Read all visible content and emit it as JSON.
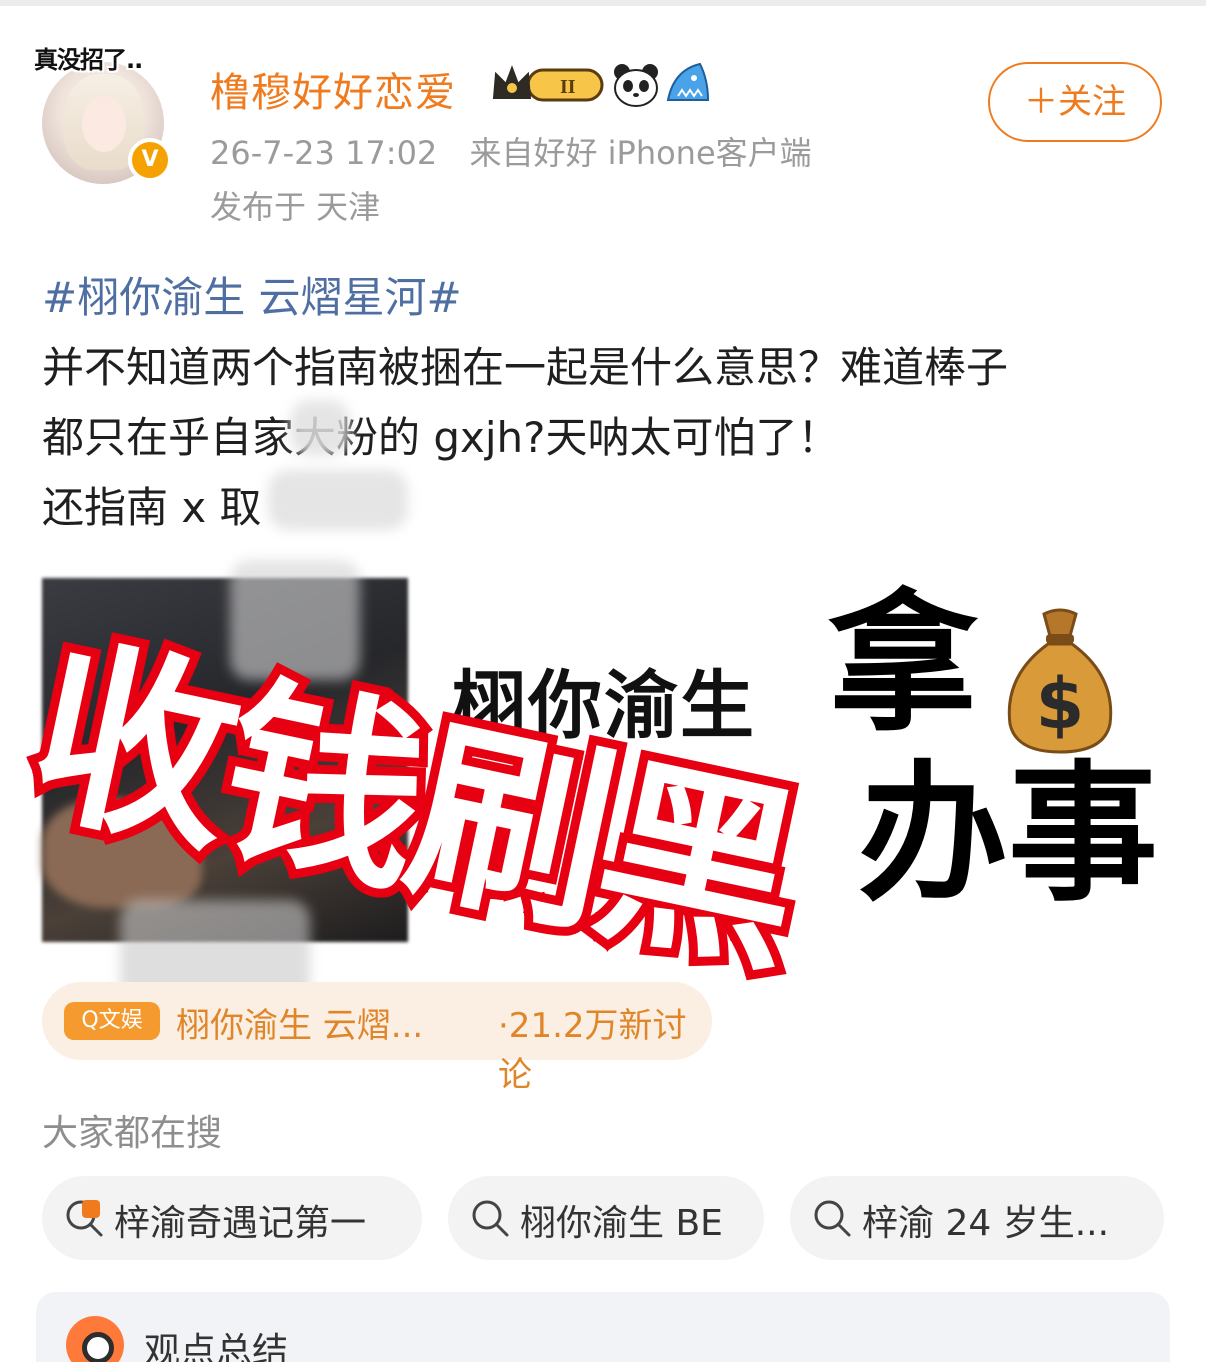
{
  "header": {
    "avatar_tag": "真没招了..",
    "username": "橹穆好好恋爱",
    "vip_level": "II",
    "timestamp": "26-7-23 17:02",
    "source": "来自好好 iPhone客户端",
    "location": "发布于 天津",
    "follow_label": "＋关注",
    "verified_mark": "V"
  },
  "post": {
    "topic": "#栩你渝生 云熠星河#",
    "line1": "并不知道两个指南被捆在一起是什么意思？难道棒子",
    "line2": "都只在乎自家大粉的 gxjh?天呐太可怕了！",
    "line3": "还指南 x 取"
  },
  "media": {
    "image_text": "栩你渝生",
    "big_text_1": "拿",
    "big_text_2": "办事",
    "stamp_text": "收钱刷黑",
    "moneybag_symbol": "$"
  },
  "hot_topic": {
    "tag": "Q文娱",
    "label": "栩你渝生 云熠...",
    "count": "·21.2万新讨论"
  },
  "searches": {
    "title": "大家都在搜",
    "items": [
      {
        "label": "梓渝奇遇记第一",
        "icon": "hot-search-icon"
      },
      {
        "label": "栩你渝生 BE",
        "icon": "search-icon"
      },
      {
        "label": "梓渝 24 岁生...",
        "icon": "search-icon"
      }
    ]
  },
  "summary": {
    "title": "观点总结"
  },
  "colors": {
    "accent": "#f07b1e",
    "topic_link": "#4f6fa3",
    "stamp_red": "#e60012"
  }
}
